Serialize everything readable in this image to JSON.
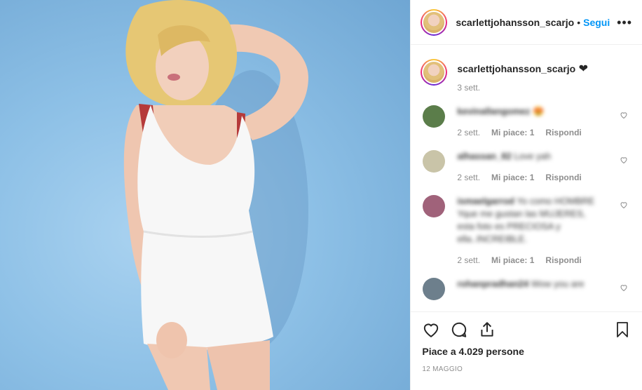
{
  "post": {
    "username": "scarlettjohansson_scarjo",
    "separator": "•",
    "follow_label": "Segui",
    "more_icon": "more-dots-icon"
  },
  "caption": {
    "username": "scarlettjohansson_scarjo",
    "text": "❤",
    "time": "3 sett."
  },
  "comments": [
    {
      "username": "kevinallangomez",
      "text": "😍",
      "time": "2 sett.",
      "likes": "Mi piace: 1",
      "reply": "Rispondi",
      "avatar_color": "#5b7d4a"
    },
    {
      "username": "alhassan_82",
      "text": "Love yah",
      "time": "2 sett.",
      "likes": "Mi piace: 1",
      "reply": "Rispondi",
      "avatar_color": "#c9c4a8"
    },
    {
      "username": "ismaelgarrod",
      "text": "Yo como HOMBRE Yque me gustan las MUJERES, esta foto es PRECIOSA y ella..INCREIBLE.",
      "time": "2 sett.",
      "likes": "Mi piace: 1",
      "reply": "Rispondi",
      "avatar_color": "#a0627a"
    },
    {
      "username": "rohanpradhan24",
      "text": "Wow you are",
      "avatar_color": "#6d7f8c"
    }
  ],
  "actions": {
    "likes_text": "Piace a 4.029 persone",
    "date": "12 MAGGIO"
  }
}
